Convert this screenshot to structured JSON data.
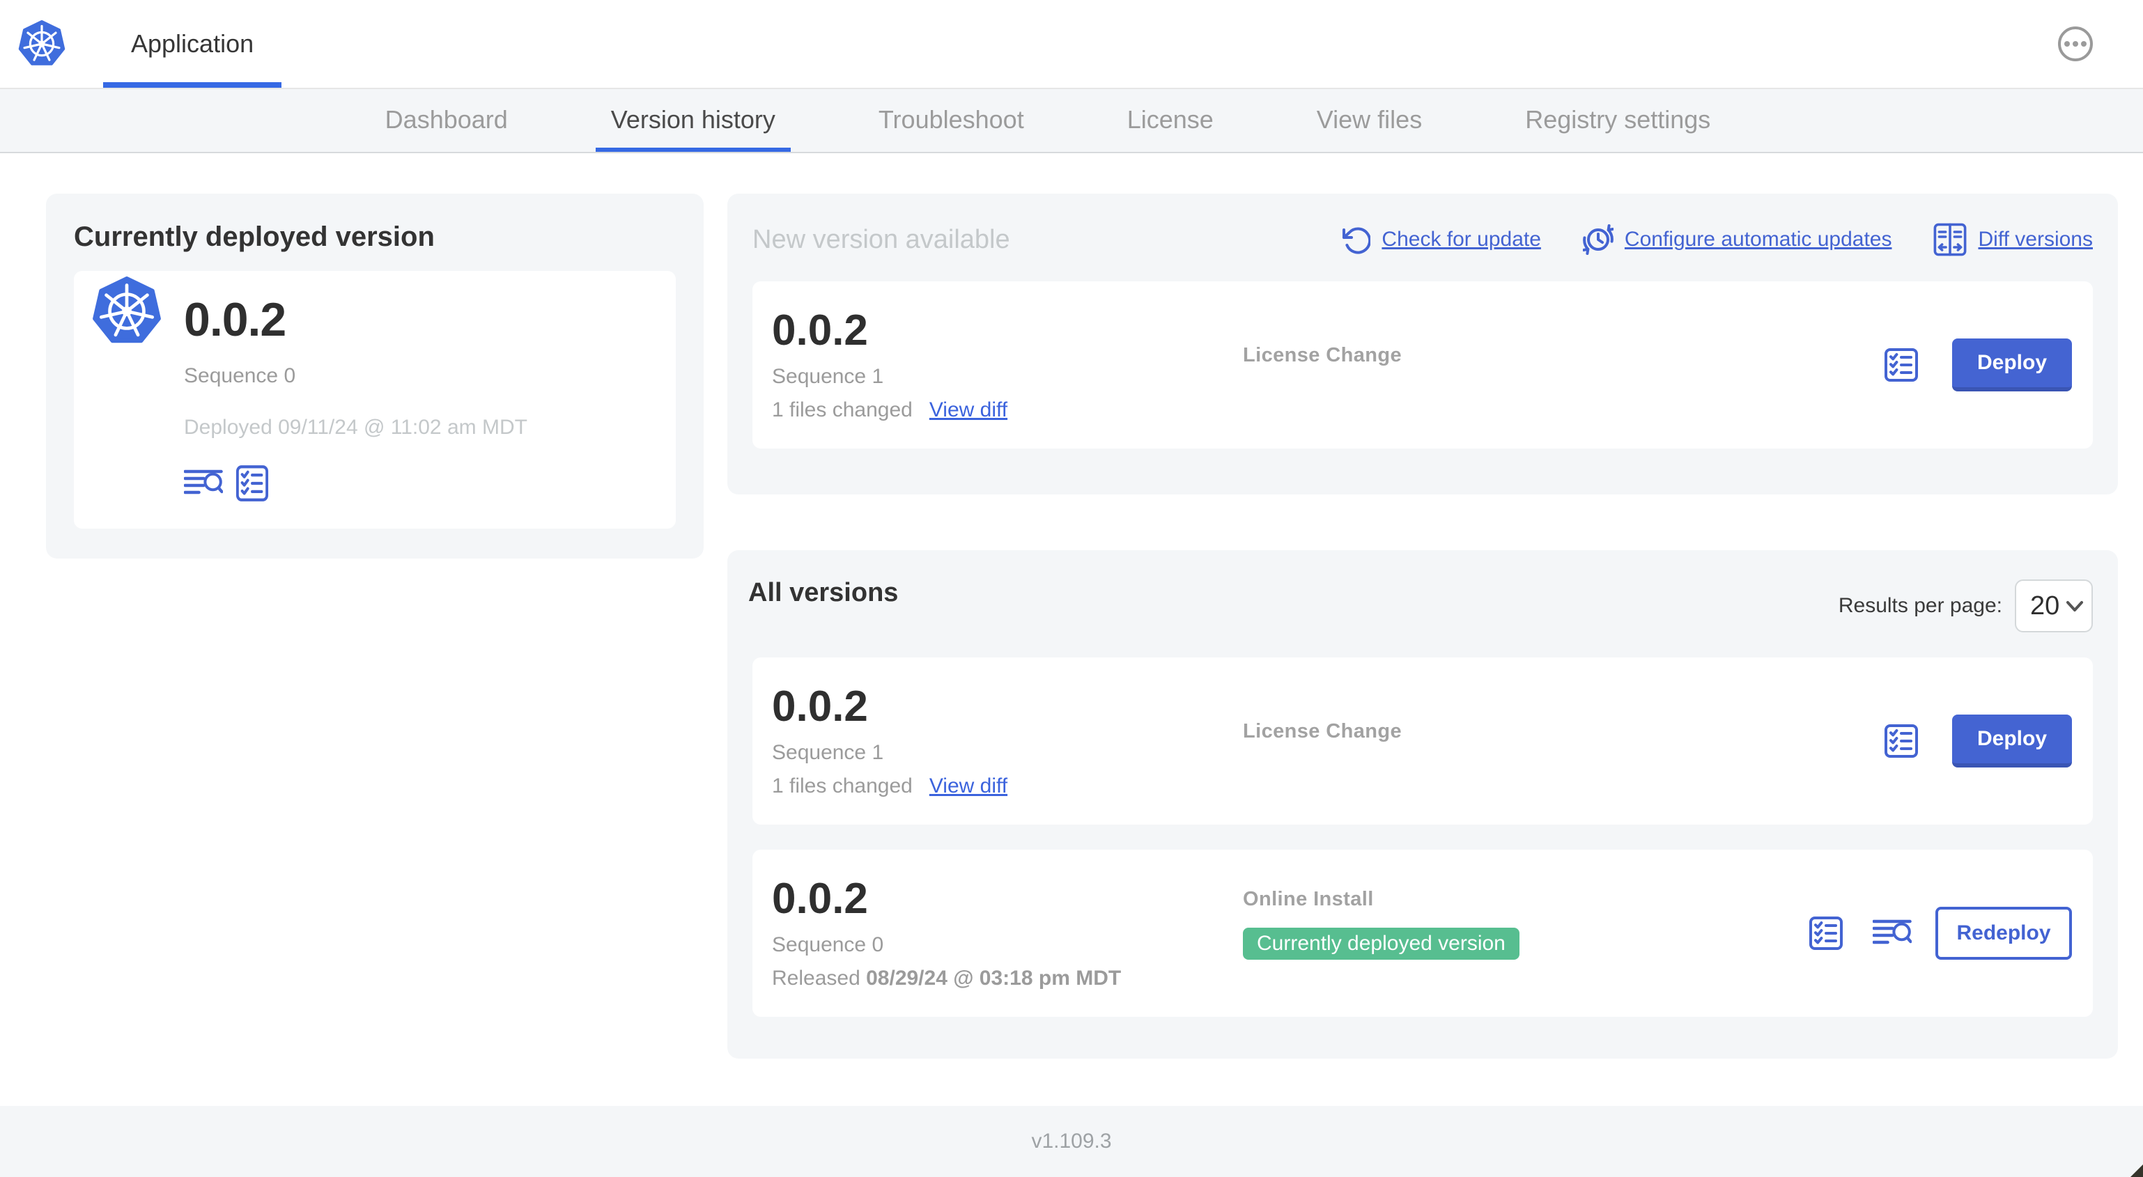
{
  "colors": {
    "accent_blue": "#4363d2",
    "underline_blue": "#3669e4",
    "badge_green": "#57be90"
  },
  "header": {
    "app_tab": "Application"
  },
  "nav": {
    "tabs": [
      "Dashboard",
      "Version history",
      "Troubleshoot",
      "License",
      "View files",
      "Registry settings"
    ],
    "active": "Version history"
  },
  "deployed_card": {
    "title": "Currently deployed version",
    "version": "0.0.2",
    "sequence": "Sequence 0",
    "deployed": "Deployed 09/11/24 @ 11:02 am MDT"
  },
  "new_version": {
    "title": "New version available",
    "links": [
      {
        "label": "Check for update"
      },
      {
        "label": "Configure automatic updates"
      },
      {
        "label": "Diff versions"
      }
    ],
    "row": {
      "version": "0.0.2",
      "sequence": "Sequence 1",
      "files_changed": "1 files changed",
      "view_diff": "View diff",
      "source": "License Change",
      "action": "Deploy"
    }
  },
  "all_versions": {
    "title": "All versions",
    "results_label": "Results per page:",
    "results_value": "20",
    "rows": [
      {
        "version": "0.0.2",
        "sequence": "Sequence 1",
        "files_changed": "1 files changed",
        "view_diff": "View diff",
        "source": "License Change",
        "action": "Deploy"
      },
      {
        "version": "0.0.2",
        "sequence": "Sequence 0",
        "released_label": "Released",
        "released_date": "08/29/24 @ 03:18 pm MDT",
        "source": "Online Install",
        "badge": "Currently deployed version",
        "action": "Redeploy"
      }
    ]
  },
  "footer": {
    "version": "v1.109.3"
  }
}
